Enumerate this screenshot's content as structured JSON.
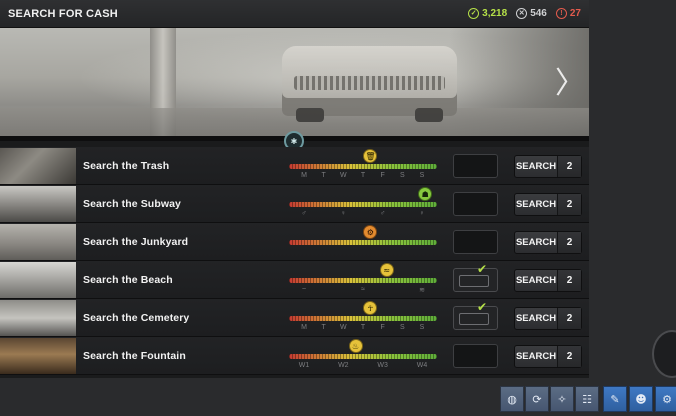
{
  "header": {
    "title": "SEARCH FOR CASH",
    "stats": {
      "success": "3,218",
      "fail": "546",
      "alert": "27"
    }
  },
  "hero": {
    "next_arrow": "〉"
  },
  "locations": [
    {
      "name": "Search the Trash",
      "ticks": [
        "M",
        "T",
        "W",
        "T",
        "F",
        "S",
        "S"
      ],
      "marker_icon": "trash-icon",
      "filled": false,
      "checked": false,
      "button": "SEARCH",
      "count": "2"
    },
    {
      "name": "Search the Subway",
      "ticks": [
        "♂",
        "♀",
        "♂",
        "♀"
      ],
      "marker_icon": "people-icon",
      "filled": false,
      "checked": false,
      "button": "SEARCH",
      "count": "2"
    },
    {
      "name": "Search the Junkyard",
      "ticks": [],
      "marker_icon": "gear-icon",
      "filled": false,
      "checked": false,
      "button": "SEARCH",
      "count": "2"
    },
    {
      "name": "Search the Beach",
      "ticks": [
        "~",
        "≈",
        "≋"
      ],
      "marker_icon": "wave-icon",
      "filled": true,
      "checked": true,
      "button": "SEARCH",
      "count": "2"
    },
    {
      "name": "Search the Cemetery",
      "ticks": [
        "M",
        "T",
        "W",
        "T",
        "F",
        "S",
        "S"
      ],
      "marker_icon": "ghost-icon",
      "filled": true,
      "checked": true,
      "button": "SEARCH",
      "count": "2"
    },
    {
      "name": "Search the Fountain",
      "ticks": [
        "W1",
        "W2",
        "W3",
        "W4"
      ],
      "marker_icon": "fountain-icon",
      "filled": false,
      "checked": false,
      "button": "SEARCH",
      "count": "2"
    }
  ],
  "meter_levels": [
    0.55,
    0.92,
    0.55,
    0.66,
    0.55,
    0.45
  ],
  "colors": {
    "accent_green": "#b5e048",
    "alert_red": "#e35b4d",
    "toolbar_blue": "#3f79c4"
  },
  "toolbar": {
    "icons": [
      "globe-icon",
      "refresh-icon",
      "lightbulb-icon",
      "network-icon",
      "pencil-icon",
      "users-icon",
      "gear-icon"
    ]
  }
}
